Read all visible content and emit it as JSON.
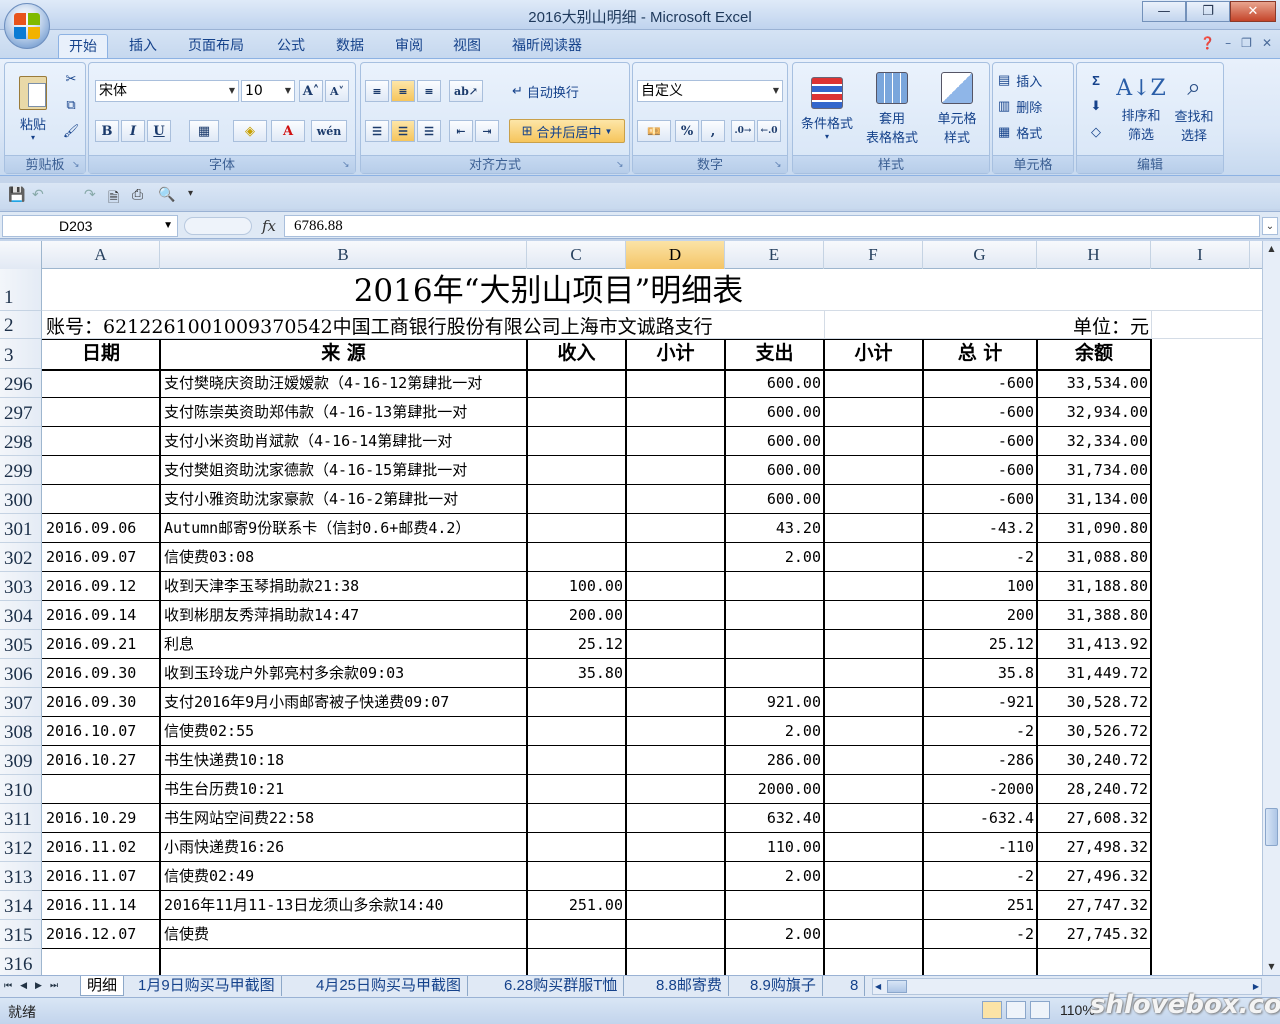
{
  "window": {
    "title": "2016大别山明细 - Microsoft Excel",
    "minimize": "—",
    "restore": "❐",
    "close": "✕"
  },
  "ribbon_tabs": [
    "开始",
    "插入",
    "页面布局",
    "公式",
    "数据",
    "审阅",
    "视图",
    "福昕阅读器"
  ],
  "ribbon": {
    "clipboard": {
      "paste": "粘贴",
      "label": "剪贴板"
    },
    "font": {
      "name": "宋体",
      "size": "10",
      "bold": "B",
      "italic": "I",
      "underline": "U",
      "grow": "A˄",
      "shrink": "A˅",
      "phonetic": "wén",
      "label": "字体"
    },
    "alignment": {
      "wrap": "自动换行",
      "merge": "合并后居中",
      "label": "对齐方式"
    },
    "number": {
      "format": "自定义",
      "percent": "%",
      "comma": ",",
      "label": "数字"
    },
    "styles": {
      "conditional": "条件格式",
      "table_1": "套用",
      "table_2": "表格格式",
      "cell_1": "单元格",
      "cell_2": "样式",
      "label": "样式"
    },
    "cells": {
      "insert": "插入",
      "delete": "删除",
      "format": "格式",
      "label": "单元格"
    },
    "editing": {
      "sigma": "Σ",
      "sort_1": "排序和",
      "sort_2": "筛选",
      "find_1": "查找和",
      "find_2": "选择",
      "label": "编辑"
    }
  },
  "formula_bar": {
    "name_box": "D203",
    "fx": "fx",
    "value": "6786.88"
  },
  "columns": [
    "A",
    "B",
    "C",
    "D",
    "E",
    "F",
    "G",
    "H",
    "I"
  ],
  "selected_column": "D",
  "sheet": {
    "title": "2016年“大别山项目”明细表",
    "account": "账号：6212261001009370542中国工商银行股份有限公司上海市文诚路支行",
    "unit": "单位：元",
    "headers": [
      "日期",
      "来 源",
      "收入",
      "小计",
      "支出",
      "小计",
      "总 计",
      "余额"
    ],
    "header_rows": [
      "1",
      "2",
      "3"
    ],
    "rows": [
      {
        "row": "296",
        "date": "",
        "source": "支付樊晓庆资助汪嫒嫒款（4-16-12第肆批一对",
        "income": "",
        "expense": "600.00",
        "total": "-600",
        "balance": "33,534.00"
      },
      {
        "row": "297",
        "date": "",
        "source": "支付陈崇英资助郑伟款（4-16-13第肆批一对",
        "income": "",
        "expense": "600.00",
        "total": "-600",
        "balance": "32,934.00"
      },
      {
        "row": "298",
        "date": "",
        "source": "支付小米资助肖斌款（4-16-14第肆批一对",
        "income": "",
        "expense": "600.00",
        "total": "-600",
        "balance": "32,334.00"
      },
      {
        "row": "299",
        "date": "",
        "source": "支付樊姐资助沈家德款（4-16-15第肆批一对",
        "income": "",
        "expense": "600.00",
        "total": "-600",
        "balance": "31,734.00"
      },
      {
        "row": "300",
        "date": "",
        "source": "支付小雅资助沈家豪款（4-16-2第肆批一对",
        "income": "",
        "expense": "600.00",
        "total": "-600",
        "balance": "31,134.00"
      },
      {
        "row": "301",
        "date": "2016.09.06",
        "source": "Autumn邮寄9份联系卡（信封0.6+邮费4.2）",
        "income": "",
        "expense": "43.20",
        "total": "-43.2",
        "balance": "31,090.80"
      },
      {
        "row": "302",
        "date": "2016.09.07",
        "source": "信使费03:08",
        "income": "",
        "expense": "2.00",
        "total": "-2",
        "balance": "31,088.80"
      },
      {
        "row": "303",
        "date": "2016.09.12",
        "source": "收到天津李玉琴捐助款21:38",
        "income": "100.00",
        "expense": "",
        "total": "100",
        "balance": "31,188.80"
      },
      {
        "row": "304",
        "date": "2016.09.14",
        "source": "收到彬朋友秀萍捐助款14:47",
        "income": "200.00",
        "expense": "",
        "total": "200",
        "balance": "31,388.80"
      },
      {
        "row": "305",
        "date": "2016.09.21",
        "source": "利息",
        "income": "25.12",
        "expense": "",
        "total": "25.12",
        "balance": "31,413.92"
      },
      {
        "row": "306",
        "date": "2016.09.30",
        "source": "收到玉玲珑户外郭亮村多余款09:03",
        "income": "35.80",
        "expense": "",
        "total": "35.8",
        "balance": "31,449.72"
      },
      {
        "row": "307",
        "date": "2016.09.30",
        "source": "支付2016年9月小雨邮寄被子快递费09:07",
        "income": "",
        "expense": "921.00",
        "total": "-921",
        "balance": "30,528.72"
      },
      {
        "row": "308",
        "date": "2016.10.07",
        "source": "信使费02:55",
        "income": "",
        "expense": "2.00",
        "total": "-2",
        "balance": "30,526.72"
      },
      {
        "row": "309",
        "date": "2016.10.27",
        "source": "书生快递费10:18",
        "income": "",
        "expense": "286.00",
        "total": "-286",
        "balance": "30,240.72"
      },
      {
        "row": "310",
        "date": "",
        "source": "书生台历费10:21",
        "income": "",
        "expense": "2000.00",
        "total": "-2000",
        "balance": "28,240.72"
      },
      {
        "row": "311",
        "date": "2016.10.29",
        "source": "书生网站空间费22:58",
        "income": "",
        "expense": "632.40",
        "total": "-632.4",
        "balance": "27,608.32"
      },
      {
        "row": "312",
        "date": "2016.11.02",
        "source": "小雨快递费16:26",
        "income": "",
        "expense": "110.00",
        "total": "-110",
        "balance": "27,498.32"
      },
      {
        "row": "313",
        "date": "2016.11.07",
        "source": "信使费02:49",
        "income": "",
        "expense": "2.00",
        "total": "-2",
        "balance": "27,496.32"
      },
      {
        "row": "314",
        "date": "2016.11.14",
        "source": "2016年11月11-13日龙须山多余款14:40",
        "income": "251.00",
        "expense": "",
        "total": "251",
        "balance": "27,747.32"
      },
      {
        "row": "315",
        "date": "2016.12.07",
        "source": "信使费",
        "income": "",
        "expense": "2.00",
        "total": "-2",
        "balance": "27,745.32"
      },
      {
        "row": "316",
        "date": "",
        "source": "",
        "income": "",
        "expense": "",
        "total": "",
        "balance": ""
      }
    ]
  },
  "sheet_tabs": [
    "明细",
    "1月9日购买马甲截图",
    "4月25日购买马甲截图",
    "6.28购买群服T恤",
    "8.8邮寄费",
    "8.9购旗子",
    "8"
  ],
  "status": {
    "ready": "就绪",
    "zoom": "110%",
    "watermark": "shlovebox.com"
  }
}
